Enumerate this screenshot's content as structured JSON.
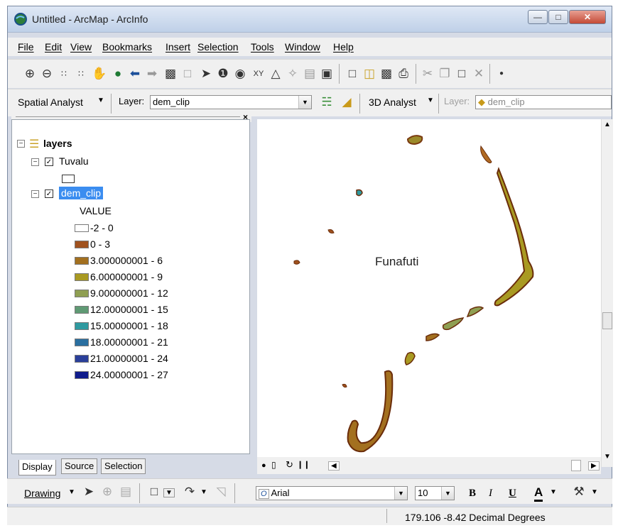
{
  "window": {
    "title": "Untitled - ArcMap - ArcInfo"
  },
  "menu": [
    "File",
    "Edit",
    "View",
    "Bookmarks",
    "Insert",
    "Selection",
    "Tools",
    "Window",
    "Help"
  ],
  "toolbar2": {
    "spatial_analyst": "Spatial Analyst",
    "layer_label": "Layer:",
    "layer_value": "dem_clip",
    "analyst3d": "3D Analyst",
    "layer2_label": "Layer:",
    "layer2_value": "dem_clip"
  },
  "toc": {
    "root": "layers",
    "group": "Tuvalu",
    "layer": "dem_clip",
    "value_header": "VALUE",
    "legend": [
      {
        "label": "-2 - 0",
        "color": "#ffffff"
      },
      {
        "label": "0 - 3",
        "color": "#a0521e"
      },
      {
        "label": "3.000000001 - 6",
        "color": "#a3701f"
      },
      {
        "label": "6.000000001 - 9",
        "color": "#a99a22"
      },
      {
        "label": "9.000000001 - 12",
        "color": "#8f9f52"
      },
      {
        "label": "12.00000001 - 15",
        "color": "#5f9a74"
      },
      {
        "label": "15.00000001 - 18",
        "color": "#2f9aa0"
      },
      {
        "label": "18.00000001 - 21",
        "color": "#2a6fa0"
      },
      {
        "label": "21.00000001 - 24",
        "color": "#2a3f9a"
      },
      {
        "label": "24.00000001 - 27",
        "color": "#101c8c"
      }
    ]
  },
  "tabs": [
    "Display",
    "Source",
    "Selection"
  ],
  "map": {
    "label": "Funafuti"
  },
  "drawbar": {
    "drawing": "Drawing",
    "font": "Arial",
    "size": "10",
    "bold": "B",
    "italic": "I",
    "underline": "U",
    "font_color": "A"
  },
  "status": {
    "coords": "179.106  -8.42 Decimal Degrees"
  }
}
